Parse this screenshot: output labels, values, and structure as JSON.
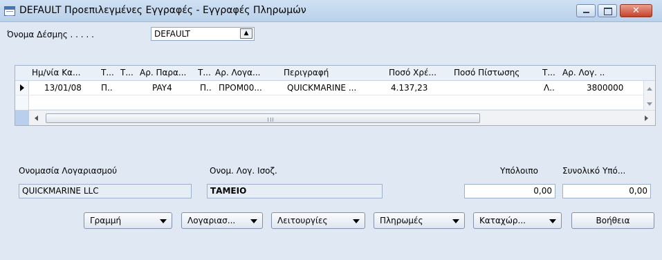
{
  "window": {
    "title": "DEFAULT Προεπιλεγμένες Εγγραφές - Εγγραφές Πληρωμών",
    "icon": "journal-window-icon"
  },
  "batch": {
    "label": "Όνομα Δέσμης . . . . .",
    "value": "DEFAULT"
  },
  "grid": {
    "columns": [
      "Ημ/νία Κα...",
      "Τ...",
      "Τ...",
      "Αρ. Παρα...",
      "Τ...",
      "Αρ. Λογα...",
      "Περιγραφή",
      "Ποσό Χρέ...",
      "Ποσό Πίστωσης",
      "Τ...",
      "Αρ. Λογ. .."
    ],
    "rows": [
      {
        "date": "13/01/08",
        "t1": "Π..",
        "t2": "",
        "doc_no": "PAY4",
        "t3": "Π..",
        "account_no": "ΠΡΟΜ00...",
        "description": "QUICKMARINE ...",
        "debit": "4.137,23",
        "credit": "",
        "t4": "Λ..",
        "bal_account_no": "3800000"
      }
    ]
  },
  "info": {
    "account_name_label": "Ονομασία Λογαριασμού",
    "account_name_value": "QUICKMARINE LLC",
    "bal_account_name_label": "Ονομ. Λογ. Ισοζ.",
    "bal_account_name_value": "ΤΑΜΕΙΟ",
    "balance_label": "Υπόλοιπο",
    "balance_value": "0,00",
    "total_balance_label": "Συνολικό Υπό...",
    "total_balance_value": "0,00"
  },
  "buttons": {
    "line": "Γραμμή",
    "account": "Λογαριασ...",
    "functions": "Λειτουργίες",
    "payments": "Πληρωμές",
    "posting": "Καταχώρ...",
    "help": "Βοήθεια"
  },
  "colors": {
    "background": "#dfe8f3",
    "titlebar": "#b9d1ea",
    "close_button": "#c4432b",
    "selection": "#b8d0ec"
  }
}
